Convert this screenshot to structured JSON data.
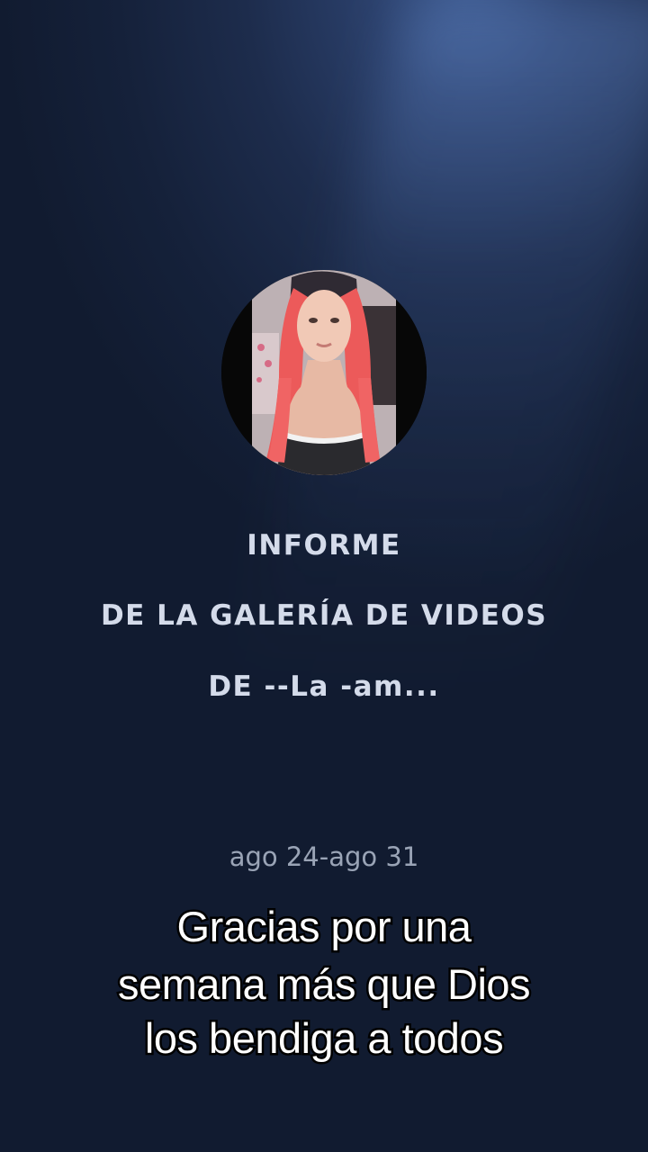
{
  "report": {
    "title_line1": "INFORME",
    "title_line2": "DE LA GALERÍA DE VIDEOS",
    "title_line3": "DE --La -am...",
    "date_range": "ago 24-ago 31"
  },
  "caption": {
    "line1": "Gracias por una",
    "line2": "semana más que Dios",
    "line3": "los bendiga a todos"
  },
  "colors": {
    "background": "#1a2846",
    "headline_text": "#d4dbea",
    "date_text": "#9aa4b6",
    "caption_fill": "#ffffff",
    "caption_stroke": "#000000"
  }
}
